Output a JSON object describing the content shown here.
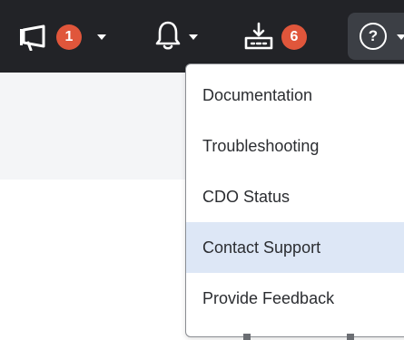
{
  "topbar": {
    "announcements": {
      "icon": "megaphone-icon",
      "count": "1"
    },
    "notifications": {
      "icon": "bell-icon"
    },
    "downloads": {
      "icon": "download-tray-icon",
      "count": "6"
    },
    "help": {
      "icon": "help-circle-icon",
      "glyph": "?"
    }
  },
  "help_menu": {
    "items": [
      {
        "label": "Documentation",
        "active": false
      },
      {
        "label": "Troubleshooting",
        "active": false
      },
      {
        "label": "CDO Status",
        "active": false
      },
      {
        "label": "Contact Support",
        "active": true
      },
      {
        "label": "Provide Feedback",
        "active": false
      }
    ]
  },
  "colors": {
    "topbar_bg": "#222327",
    "badge": "#e0563b",
    "menu_highlight": "#dde7f6"
  }
}
